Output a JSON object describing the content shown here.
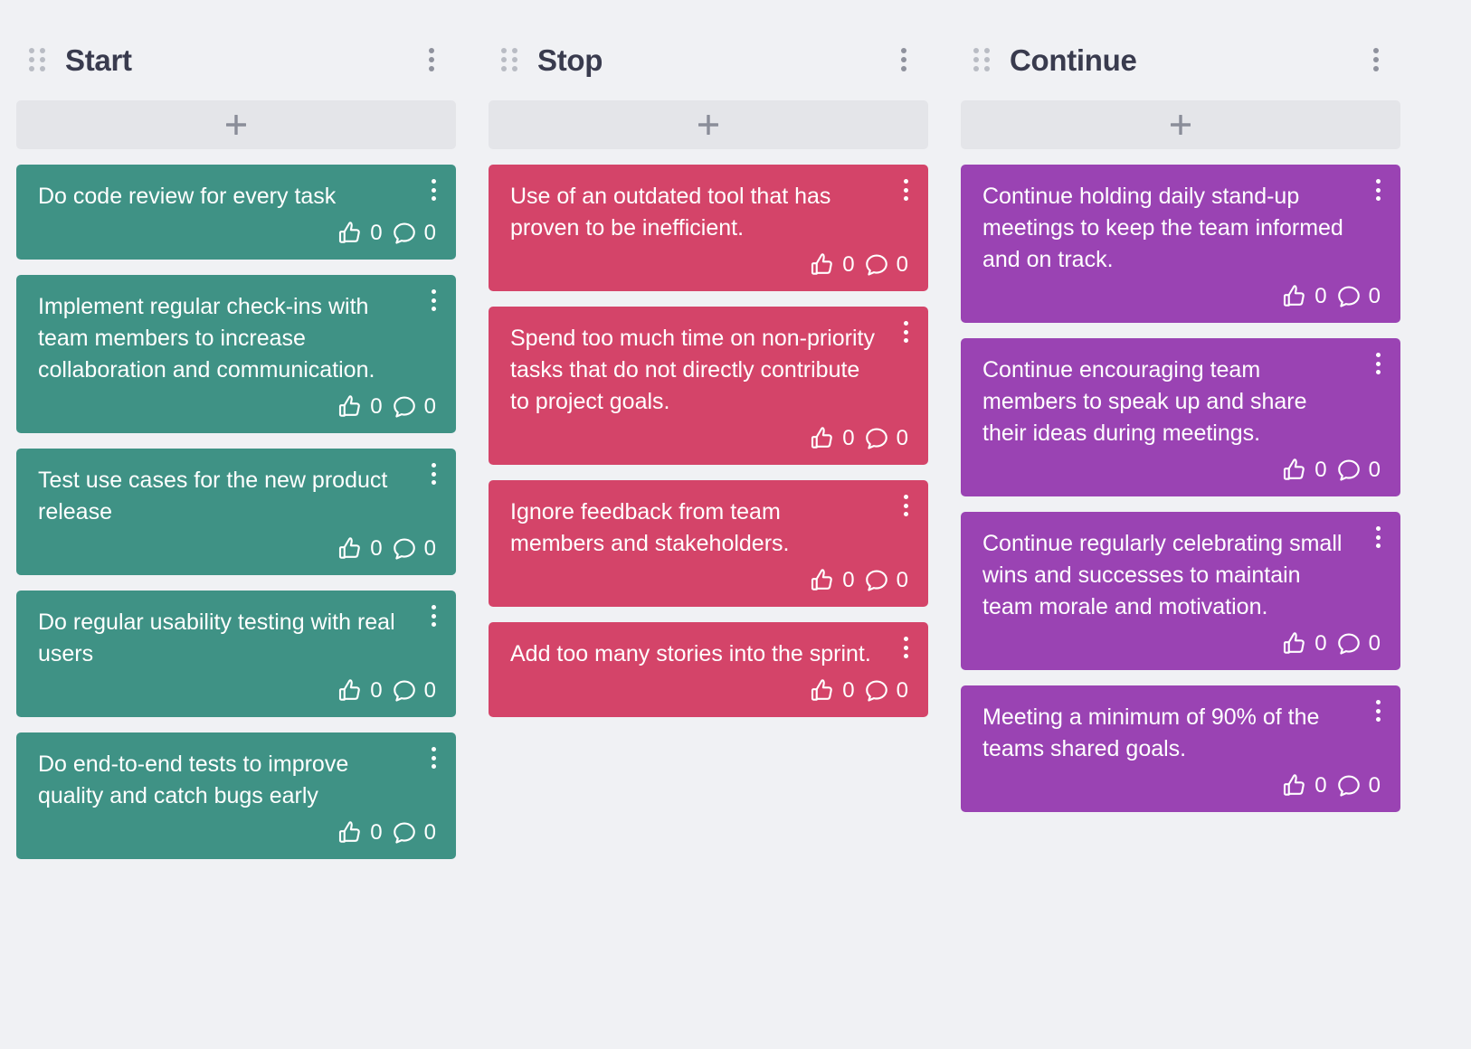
{
  "board": {
    "add_button_icon": "plus-icon",
    "drag_handle_icon": "drag-handle-icon",
    "menu_icon": "kebab-menu-icon",
    "like_icon": "thumbs-up-icon",
    "comment_icon": "comment-bubble-icon",
    "colors": {
      "background": "#f0f1f4",
      "start_card": "#3f9285",
      "stop_card": "#d44469",
      "continue_card": "#9a43b3",
      "add_button": "#e4e5e9",
      "title_text": "#393b4e",
      "handle_dot": "#b9bcc4",
      "menu_dot": "#8f929d"
    }
  },
  "columns": [
    {
      "title": "Start",
      "color_class": "green",
      "cards": [
        {
          "text": "Do code review for every task",
          "likes": "0",
          "comments": "0"
        },
        {
          "text": "Implement regular check-ins with team members to increase collaboration and communication.",
          "likes": "0",
          "comments": "0"
        },
        {
          "text": "Test use cases for the new product release",
          "likes": "0",
          "comments": "0"
        },
        {
          "text": "Do regular usability testing with real users",
          "likes": "0",
          "comments": "0"
        },
        {
          "text": "Do end-to-end tests to improve quality and catch bugs early",
          "likes": "0",
          "comments": "0"
        }
      ]
    },
    {
      "title": "Stop",
      "color_class": "red",
      "cards": [
        {
          "text": "Use of an outdated tool that has proven to be inefficient.",
          "likes": "0",
          "comments": "0"
        },
        {
          "text": "Spend too much time on non-priority tasks that do not directly contribute to project goals.",
          "likes": "0",
          "comments": "0"
        },
        {
          "text": "Ignore feedback from team members and stakeholders.",
          "likes": "0",
          "comments": "0"
        },
        {
          "text": "Add too many stories into the sprint.",
          "likes": "0",
          "comments": "0"
        }
      ]
    },
    {
      "title": "Continue",
      "color_class": "purple",
      "cards": [
        {
          "text": "Continue holding daily stand-up meetings to keep the team informed and on track.",
          "likes": "0",
          "comments": "0"
        },
        {
          "text": "Continue encouraging team members to speak up and share their ideas during meetings.",
          "likes": "0",
          "comments": "0"
        },
        {
          "text": "Continue regularly celebrating small wins and successes to maintain team morale and motivation.",
          "likes": "0",
          "comments": "0"
        },
        {
          "text": "Meeting a minimum of 90% of the teams shared goals.",
          "likes": "0",
          "comments": "0"
        }
      ]
    }
  ]
}
